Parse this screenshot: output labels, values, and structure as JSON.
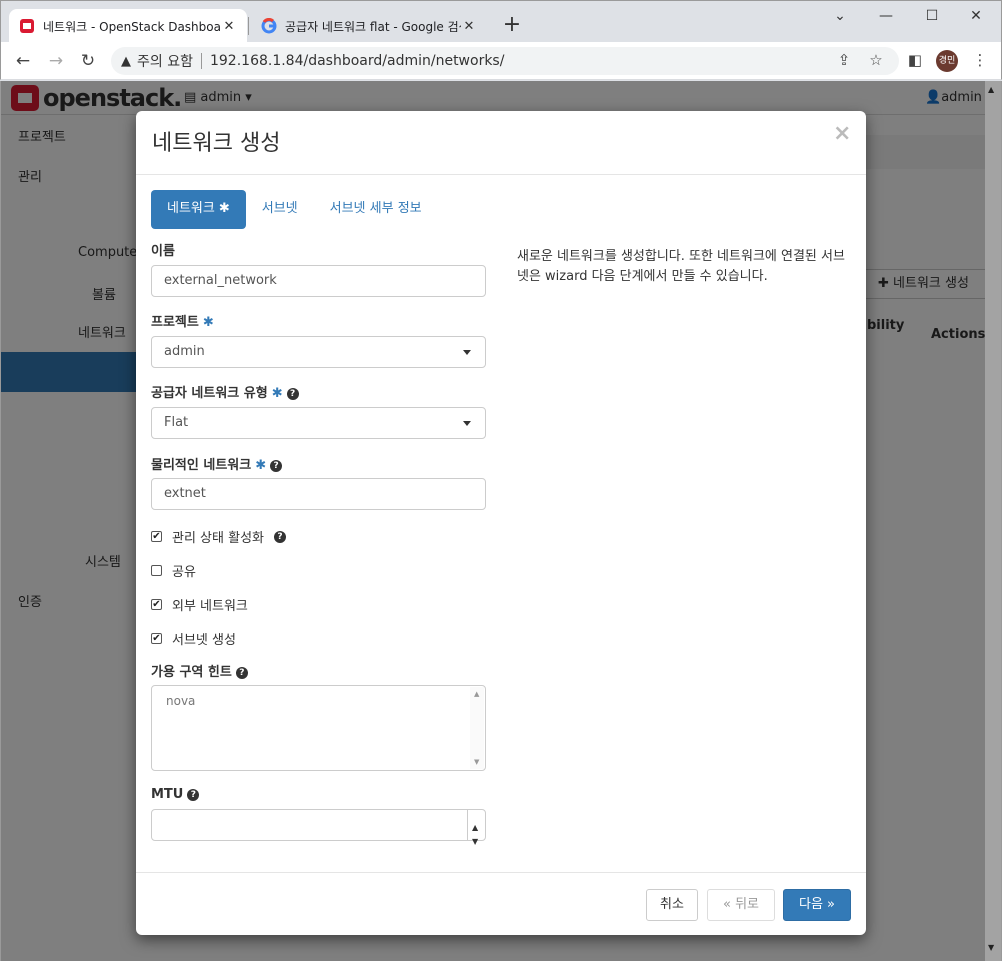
{
  "browser": {
    "tabs": [
      {
        "title": "네트워크 - OpenStack Dashboard",
        "close": "✕"
      },
      {
        "title": "공급자 네트워크 flat - Google 검색",
        "close": "✕"
      }
    ],
    "new_tab": "+",
    "window_controls": {
      "dropdown": "⌄",
      "minimize": "—",
      "maximize": "☐",
      "close": "✕"
    },
    "security_label": "주의 요함",
    "url": "192.168.1.84/dashboard/admin/networks/",
    "profile_initials": "경민"
  },
  "app": {
    "logo_text": "openstack.",
    "project_menu": "admin ▾",
    "user_menu": "admin ▾",
    "sidebar": {
      "project": "프로젝트",
      "admin": "관리",
      "compute": "Compute",
      "volume": "볼륨",
      "network": "네트워크",
      "system": "시스템",
      "identity": "인증"
    },
    "create_network_button": "✚ 네트워크 생성",
    "columns": {
      "availability": "bility",
      "actions": "Actions"
    }
  },
  "modal": {
    "title": "네트워크 생성",
    "close": "×",
    "tabs": [
      {
        "label": "네트워크",
        "required": "✱"
      },
      {
        "label": "서브넷"
      },
      {
        "label": "서브넷 세부 정보"
      }
    ],
    "required_mark": "✱",
    "help_mark": "?",
    "fields": {
      "name_label": "이름",
      "name_value": "external_network",
      "project_label": "프로젝트",
      "project_value": "admin",
      "provider_type_label": "공급자 네트워크 유형",
      "provider_type_value": "Flat",
      "physical_network_label": "물리적인 네트워크",
      "physical_network_value": "extnet",
      "admin_state_label": "관리 상태 활성화",
      "shared_label": "공유",
      "external_label": "외부 네트워크",
      "create_subnet_label": "서브넷 생성",
      "az_hint_label": "가용 구역 힌트",
      "az_hint_value": "nova",
      "mtu_label": "MTU",
      "mtu_value": ""
    },
    "checkboxes": {
      "admin_state": true,
      "shared": false,
      "external": true,
      "create_subnet": true
    },
    "help_text": "새로운 네트워크를 생성합니다. 또한 네트워크에 연결된 서브넷은 wizard 다음 단계에서 만들 수 있습니다.",
    "buttons": {
      "cancel": "취소",
      "back": "« 뒤로",
      "next": "다음 »"
    }
  }
}
